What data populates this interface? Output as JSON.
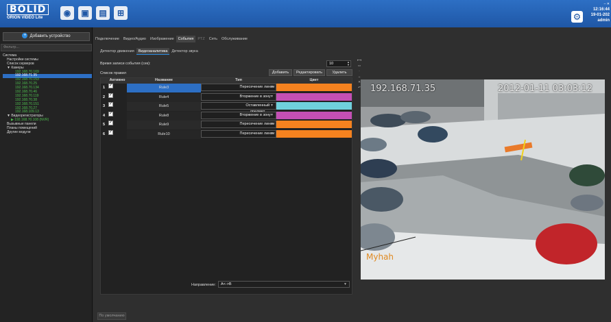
{
  "topbar": {
    "logo_brand": "BOLID",
    "logo_sub": "ORION VIDEO Lite",
    "time": "12:16:44",
    "date": "19-01-202",
    "user": "admin",
    "window_icons": "– ✕"
  },
  "sidebar": {
    "add_device_label": "Добавить устройство",
    "filter_placeholder": "Фильтр...",
    "tree": [
      {
        "label": "Система",
        "cls": "",
        "indent": 0
      },
      {
        "label": "Настройки системы",
        "cls": "",
        "indent": 6
      },
      {
        "label": "Список серверов",
        "cls": "",
        "indent": 6
      },
      {
        "label": "▼ Камеры",
        "cls": "",
        "indent": 6
      },
      {
        "label": "192.168.70.169",
        "cls": "g",
        "indent": 18
      },
      {
        "label": "192.168.71.35",
        "cls": "sel",
        "indent": 18
      },
      {
        "label": "192.168.70.153",
        "cls": "g",
        "indent": 18
      },
      {
        "label": "192.168.70.25",
        "cls": "g",
        "indent": 18
      },
      {
        "label": "192.168.70.134",
        "cls": "g",
        "indent": 18
      },
      {
        "label": "192.168.70.46",
        "cls": "g",
        "indent": 18
      },
      {
        "label": "192.168.70.119",
        "cls": "g",
        "indent": 18
      },
      {
        "label": "192.168.70.38",
        "cls": "g",
        "indent": 18
      },
      {
        "label": "192.168.70.151",
        "cls": "g",
        "indent": 18
      },
      {
        "label": "192.168.70.27",
        "cls": "g",
        "indent": 18
      },
      {
        "label": "192.168.109.13",
        "cls": "g",
        "indent": 18
      },
      {
        "label": "▼ Видеорегистраторы",
        "cls": "",
        "indent": 6
      },
      {
        "label": "▶ 192.168.70.108 (NVR)",
        "cls": "g",
        "indent": 12
      },
      {
        "label": "Вызывные панели",
        "cls": "",
        "indent": 6
      },
      {
        "label": "Планы помещений",
        "cls": "",
        "indent": 6
      },
      {
        "label": "Другие модули",
        "cls": "",
        "indent": 6
      }
    ]
  },
  "tabs_main": [
    {
      "label": "Подключение",
      "state": ""
    },
    {
      "label": "Видео/Аудио",
      "state": ""
    },
    {
      "label": "Изображение",
      "state": ""
    },
    {
      "label": "События",
      "state": "act"
    },
    {
      "label": "PTZ",
      "state": "dis"
    },
    {
      "label": "Сеть",
      "state": ""
    },
    {
      "label": "Обслуживание",
      "state": ""
    }
  ],
  "tabs_sub": [
    {
      "label": "Детектор движения",
      "state": ""
    },
    {
      "label": "Видеоаналитика",
      "state": "act"
    },
    {
      "label": "Детектор звука",
      "state": ""
    }
  ],
  "record_time_label": "Время записи события (сек):",
  "record_time_value": "10",
  "rules_label": "Список правил",
  "buttons": {
    "add": "Добавить",
    "edit": "Редактировать",
    "delete": "Удалить"
  },
  "table": {
    "headers": {
      "active": "Активно",
      "name": "Название",
      "type": "Тип",
      "color": "Цвет"
    },
    "rows": [
      {
        "num": "1",
        "name": "Rule3",
        "type": "Пересечение линии",
        "color": "#f5821f",
        "selected": true
      },
      {
        "num": "2",
        "name": "Rule4",
        "type": "Вторжение в зону",
        "color": "#c44fb4",
        "selected": false
      },
      {
        "num": "3",
        "name": "Rule5",
        "type": "Оставленный предмет",
        "color": "#6fd0dc",
        "selected": false
      },
      {
        "num": "4",
        "name": "Rule8",
        "type": "Вторжение в зону",
        "color": "#c44fb4",
        "selected": false
      },
      {
        "num": "5",
        "name": "Rule9",
        "type": "Пересечение линии",
        "color": "#f5821f",
        "selected": false
      },
      {
        "num": "6",
        "name": "Rule10",
        "type": "Пересечение линии",
        "color": "#f5821f",
        "selected": false
      }
    ]
  },
  "direction_label": "Направление:",
  "direction_value": "A<->B",
  "default_button": "По умолчанию",
  "camera": {
    "osd_ip": "192.168.71.35",
    "osd_datetime": "2012-01-11 03:03:12",
    "osd_name": "Myhah"
  }
}
